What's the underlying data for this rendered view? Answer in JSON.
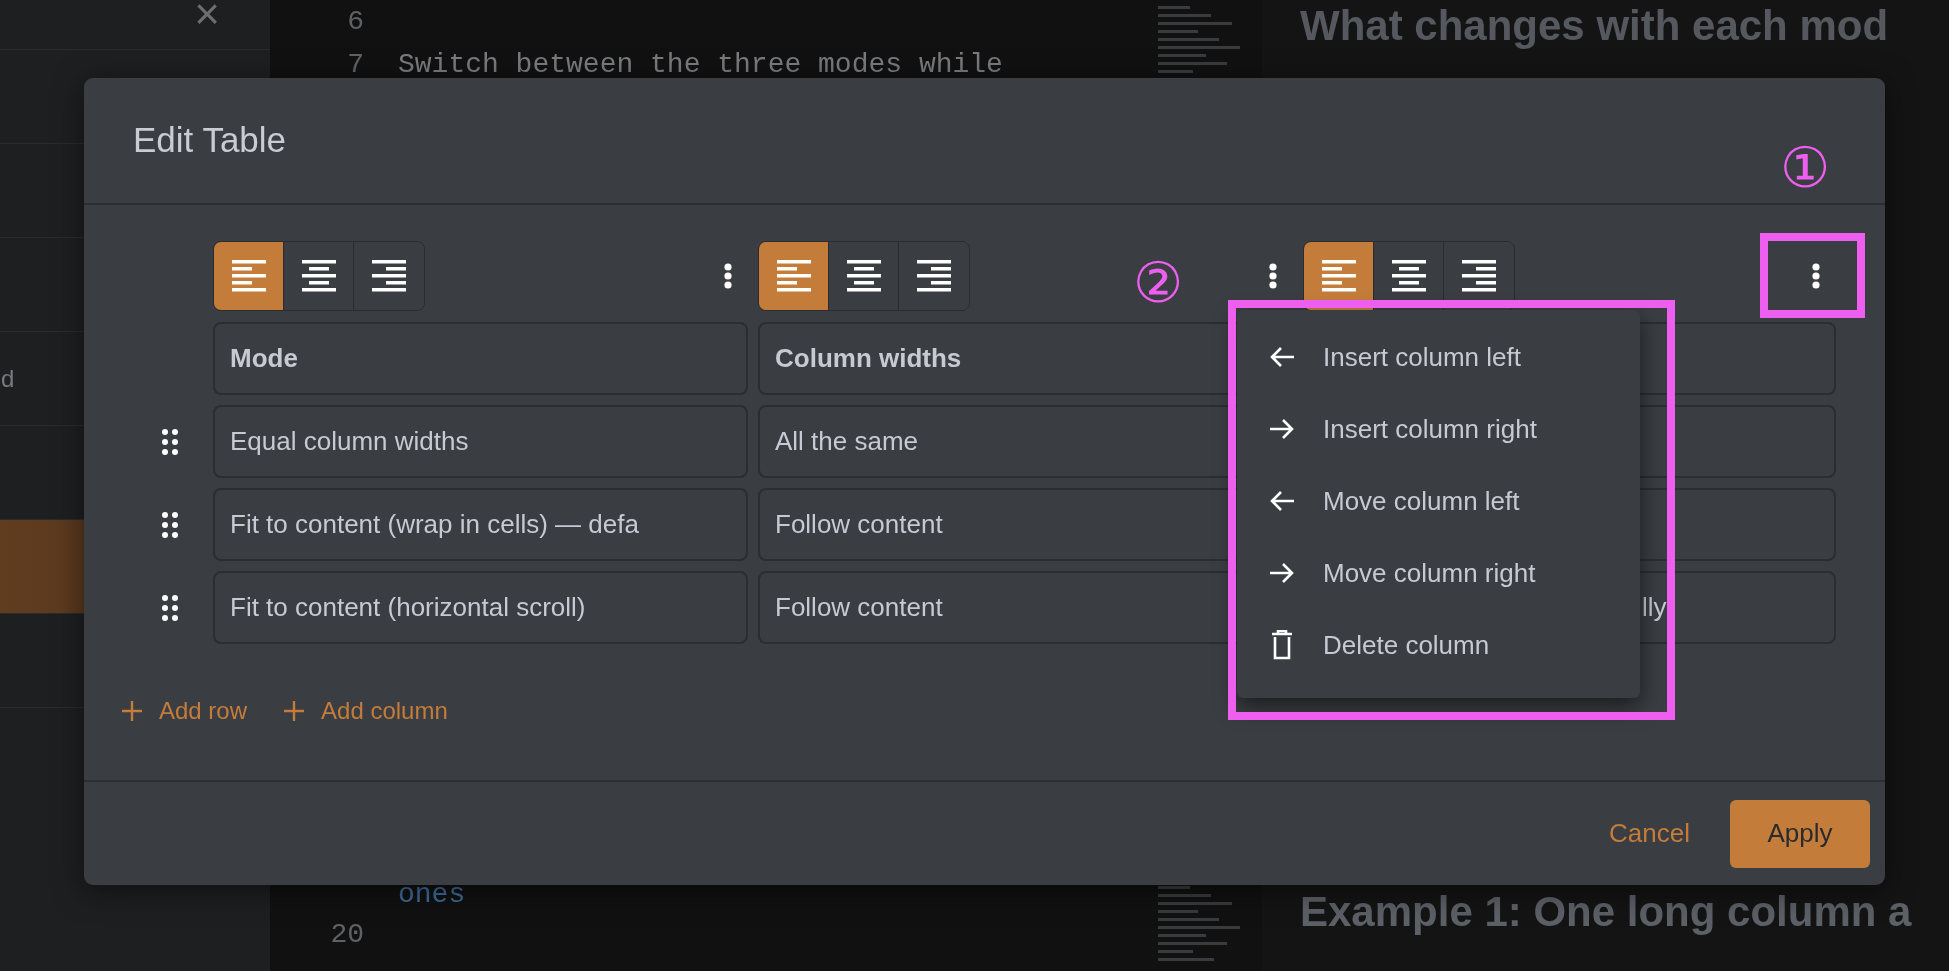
{
  "sidebar": {
    "close": "×",
    "items": [
      {
        "selected": false
      },
      {
        "selected": false
      },
      {
        "selected": false
      },
      {
        "label": "d",
        "selected": false
      },
      {
        "selected": false
      },
      {
        "selected": true
      },
      {
        "selected": false
      }
    ]
  },
  "editor": {
    "top_lines": [
      {
        "number": "6",
        "link": false
      },
      {
        "number": "7",
        "text": "Switch between the three modes while",
        "link": false
      }
    ],
    "bottom_lines": [
      {
        "text": "ones",
        "link": true
      },
      {
        "number": "20",
        "link": false
      }
    ]
  },
  "preview": {
    "heading": "What changes with each mod",
    "subheading": "Example 1: One long column a"
  },
  "dialog": {
    "title": "Edit Table",
    "columns": [
      {
        "header": "Mode",
        "align_buttons": [
          {
            "selected": true
          },
          {
            "selected": false
          },
          {
            "selected": false
          }
        ]
      },
      {
        "header": "Column widths",
        "align_buttons": [
          {
            "selected": true
          },
          {
            "selected": false
          },
          {
            "selected": false
          }
        ]
      },
      {
        "align_buttons": [
          {
            "selected": true
          },
          {
            "selected": false
          },
          {
            "selected": false
          }
        ]
      }
    ],
    "rows": [
      {
        "cells": [
          "Equal column widths",
          "All the same",
          ""
        ]
      },
      {
        "cells": [
          "Fit to content (wrap in cells) — defa",
          "Follow content",
          ""
        ]
      },
      {
        "cells": [
          "Fit to content (horizontal scroll)",
          "Follow content",
          "lly"
        ]
      }
    ],
    "add_row": "Add row",
    "add_column": "Add column",
    "cancel": "Cancel",
    "apply": "Apply",
    "column_menu": {
      "items": [
        {
          "label": "Insert column left",
          "kind": "left"
        },
        {
          "label": "Insert column right",
          "kind": "right"
        },
        {
          "label": "Move column left",
          "kind": "left"
        },
        {
          "label": "Move column right",
          "kind": "right"
        },
        {
          "label": "Delete column",
          "kind": "delete"
        }
      ]
    }
  },
  "annotations": [
    {
      "label": "①"
    },
    {
      "label": "②"
    }
  ]
}
